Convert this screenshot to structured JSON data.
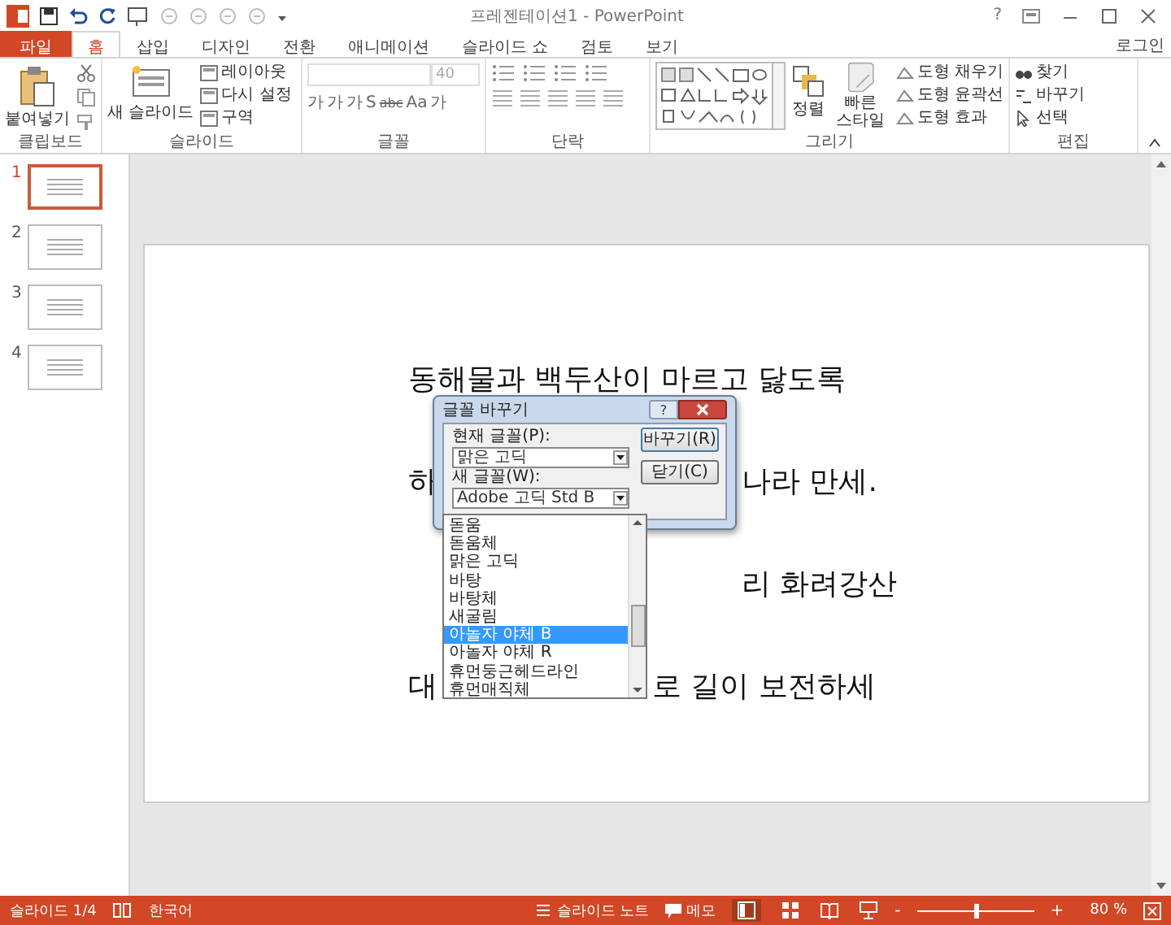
{
  "window": {
    "title": "프레젠테이션1 - PowerPoint",
    "help": "?"
  },
  "tabs": [
    {
      "label": "파일",
      "kind": "file",
      "selected": false
    },
    {
      "label": "홈",
      "kind": "tab",
      "selected": true
    },
    {
      "label": "삽입",
      "kind": "tab",
      "selected": false
    },
    {
      "label": "디자인",
      "kind": "tab",
      "selected": false
    },
    {
      "label": "전환",
      "kind": "tab",
      "selected": false
    },
    {
      "label": "애니메이션",
      "kind": "tab",
      "selected": false
    },
    {
      "label": "슬라이드 쇼",
      "kind": "tab",
      "selected": false
    },
    {
      "label": "검토",
      "kind": "tab",
      "selected": false
    },
    {
      "label": "보기",
      "kind": "tab",
      "selected": false
    }
  ],
  "account": "로그인",
  "ribbon": {
    "groups": [
      {
        "kind": "clipboard",
        "label": "클립보드",
        "paste": "붙여넣기"
      },
      {
        "kind": "slides",
        "label": "슬라이드",
        "new_slide": "새 슬라이드",
        "items": [
          "레이아웃",
          "다시 설정",
          "구역"
        ]
      },
      {
        "kind": "font",
        "label": "글꼴",
        "size": "40",
        "buttons": [
          "가",
          "가",
          "가",
          "S",
          "abc",
          "Aa",
          "가"
        ]
      },
      {
        "kind": "paragraph",
        "label": "단락"
      },
      {
        "kind": "drawing",
        "label": "그리기",
        "arrange": "정렬",
        "quick_styles": "빠른 스타일",
        "items": [
          "도형 채우기",
          "도형 윤곽선",
          "도형 효과"
        ]
      },
      {
        "kind": "editing",
        "label": "편집",
        "items": [
          "찾기",
          "바꾸기",
          "선택"
        ]
      }
    ]
  },
  "thumbnails": [
    {
      "number": "1",
      "selected": true
    },
    {
      "number": "2",
      "selected": false
    },
    {
      "number": "3",
      "selected": false
    },
    {
      "number": "4",
      "selected": false
    }
  ],
  "slide": {
    "lines": [
      {
        "left": "동해물과 백두산이 마르고 닳도록"
      },
      {
        "left": "하",
        "right": "나라 만세."
      },
      {
        "right": "리 화려강산"
      },
      {
        "left": "대",
        "right": "로 길이 보전하세"
      }
    ]
  },
  "dialog": {
    "title": "글꼴 바꾸기",
    "help": "?",
    "current_label": "현재 글꼴(P):",
    "current_value": "맑은 고딕",
    "new_label": "새 글꼴(W):",
    "new_value": "Adobe 고딕 Std B",
    "buttons": [
      "바꾸기(R)",
      "닫기(C)"
    ],
    "options": [
      {
        "label": "돋움",
        "selected": false
      },
      {
        "label": "돋움체",
        "selected": false
      },
      {
        "label": "맑은 고딕",
        "selected": false
      },
      {
        "label": "바탕",
        "selected": false
      },
      {
        "label": "바탕체",
        "selected": false
      },
      {
        "label": "새굴림",
        "selected": false
      },
      {
        "label": "아놀자 야체 B",
        "selected": true
      },
      {
        "label": "아놀자 야체 R",
        "selected": false
      },
      {
        "label": "휴먼둥근헤드라인",
        "selected": false
      },
      {
        "label": "휴먼매직체",
        "selected": false
      }
    ]
  },
  "status_bar": {
    "slide": "슬라이드 1/4",
    "language": "한국어",
    "notes": "슬라이드 노트",
    "comments": "메모",
    "zoom_out": "-",
    "zoom_in": "+",
    "zoom": "80 %",
    "zoom_slider": {
      "level": 0.5
    }
  }
}
